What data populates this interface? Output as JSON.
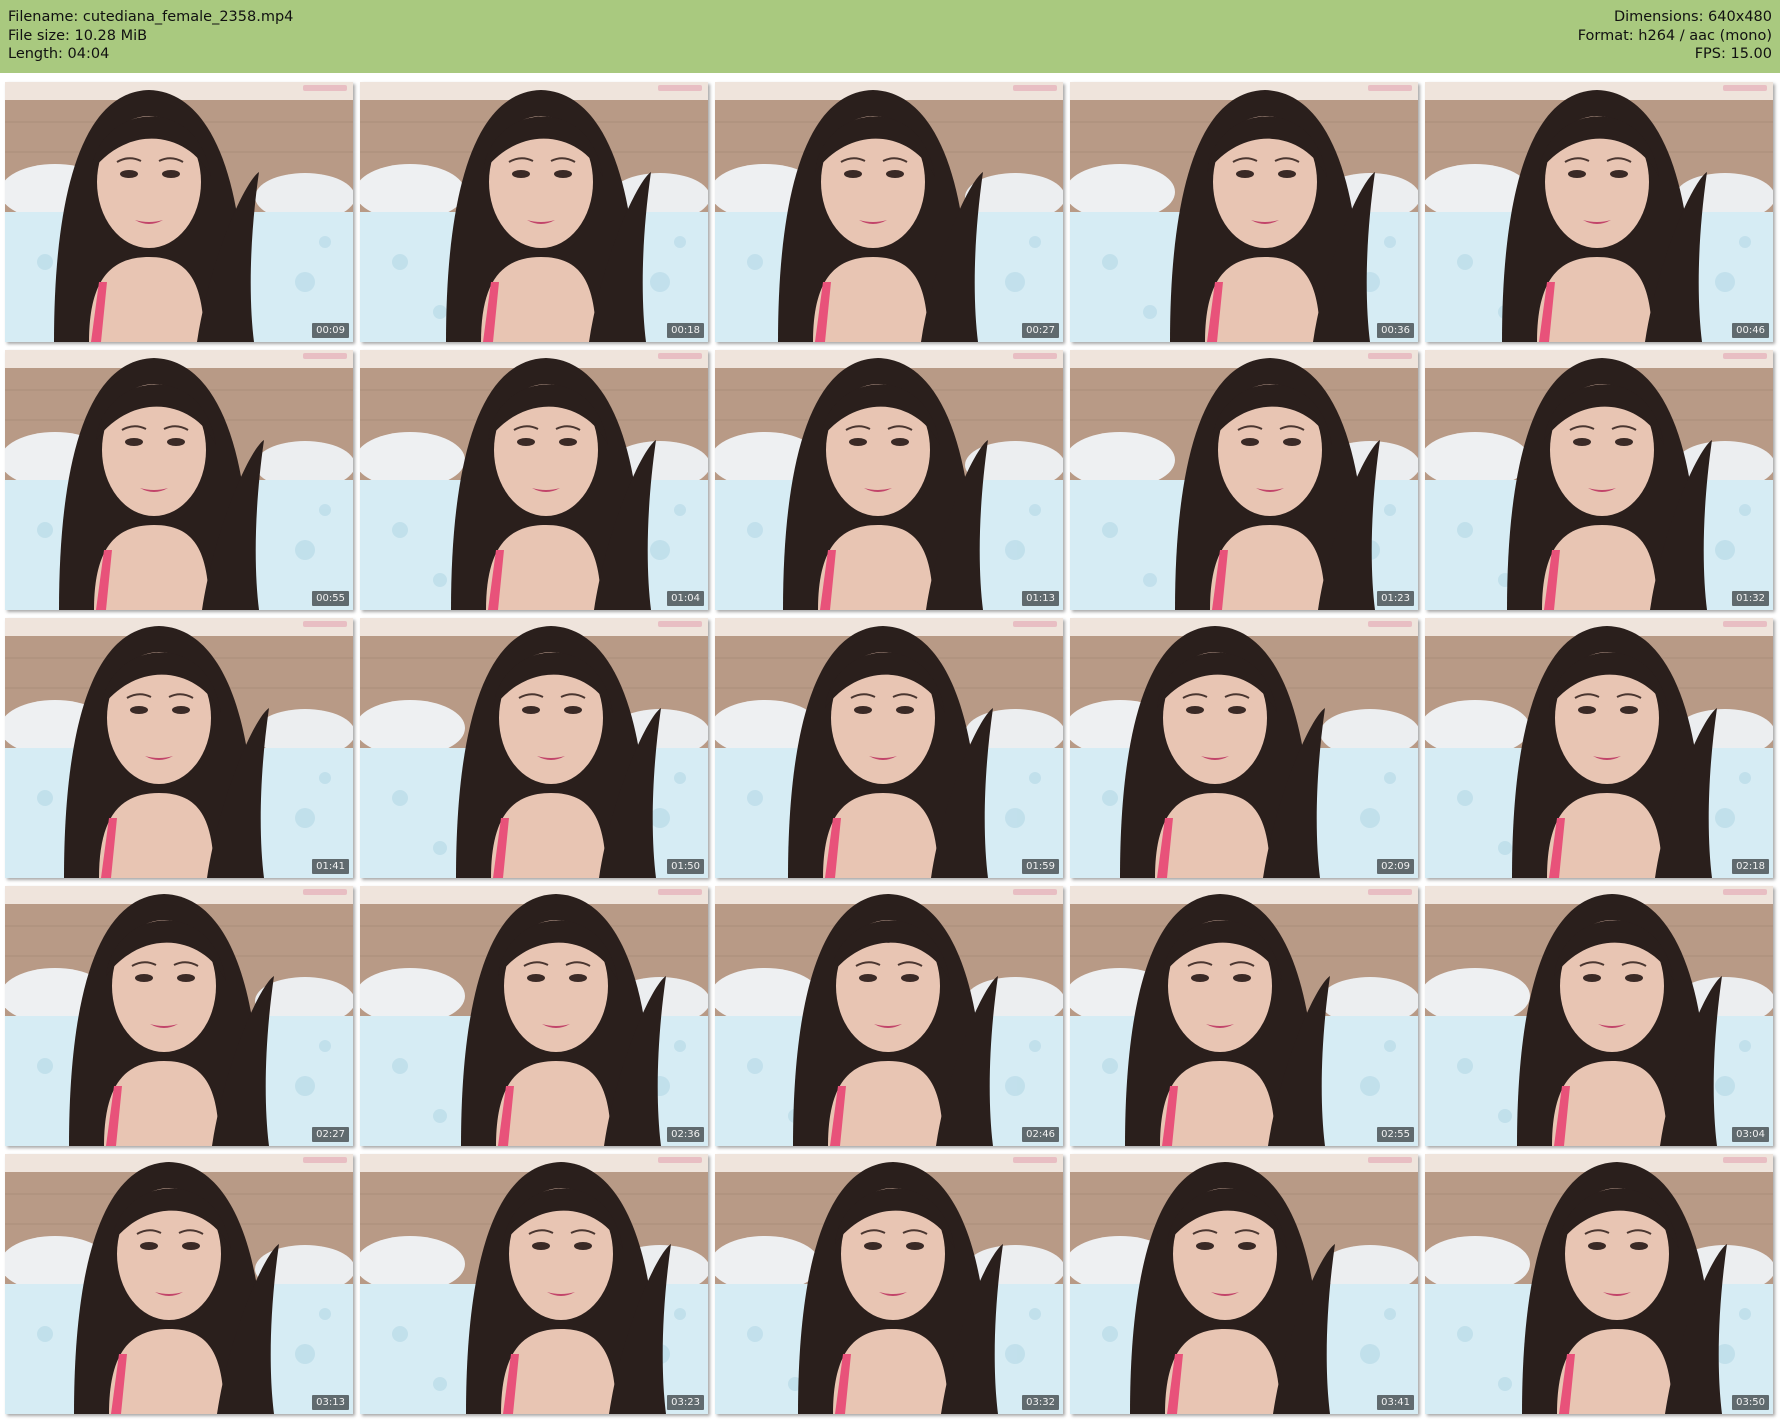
{
  "file_info": {
    "filename_line": "Filename: cutediana_female_2358.mp4",
    "filesize_line": "File size: 10.28 MiB",
    "length_line": "Length: 04:04",
    "dimensions_line": "Dimensions: 640x480",
    "format_line": "Format: h264 / aac (mono)",
    "fps_line": "FPS: 15.00"
  },
  "colors": {
    "header_bg": "#a9c97f",
    "wall": "#b89a86",
    "sheet": "#d6ecf4",
    "hair": "#2a1f1c",
    "skin": "#e8c5b3",
    "top_pink": "#e8527a"
  },
  "thumbnails": [
    {
      "time": "00:09"
    },
    {
      "time": "00:18"
    },
    {
      "time": "00:27"
    },
    {
      "time": "00:36"
    },
    {
      "time": "00:46"
    },
    {
      "time": "00:55"
    },
    {
      "time": "01:04"
    },
    {
      "time": "01:13"
    },
    {
      "time": "01:23"
    },
    {
      "time": "01:32"
    },
    {
      "time": "01:41"
    },
    {
      "time": "01:50"
    },
    {
      "time": "01:59"
    },
    {
      "time": "02:09"
    },
    {
      "time": "02:18"
    },
    {
      "time": "02:27"
    },
    {
      "time": "02:36"
    },
    {
      "time": "02:46"
    },
    {
      "time": "02:55"
    },
    {
      "time": "03:04"
    },
    {
      "time": "03:13"
    },
    {
      "time": "03:23"
    },
    {
      "time": "03:32"
    },
    {
      "time": "03:41"
    },
    {
      "time": "03:50"
    }
  ]
}
